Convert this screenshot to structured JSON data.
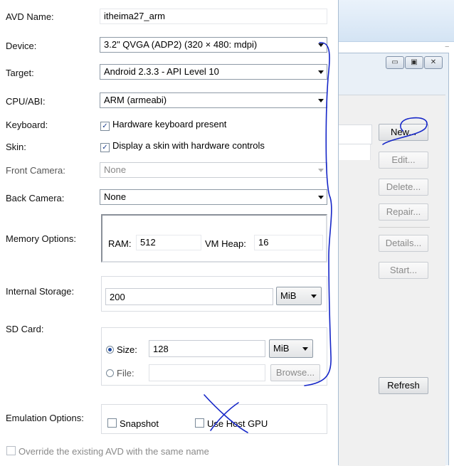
{
  "form": {
    "avd_name": {
      "label": "AVD Name:",
      "value": "itheima27_arm"
    },
    "device": {
      "label": "Device:",
      "value": "3.2\" QVGA (ADP2) (320 × 480: mdpi)"
    },
    "target": {
      "label": "Target:",
      "value": "Android 2.3.3 - API Level 10"
    },
    "cpu_abi": {
      "label": "CPU/ABI:",
      "value": "ARM (armeabi)"
    },
    "keyboard": {
      "label": "Keyboard:",
      "option": "Hardware keyboard present",
      "checked": true
    },
    "skin": {
      "label": "Skin:",
      "option": "Display a skin with hardware controls",
      "checked": true
    },
    "front_camera": {
      "label": "Front Camera:",
      "value": "None"
    },
    "back_camera": {
      "label": "Back Camera:",
      "value": "None"
    },
    "memory": {
      "label": "Memory Options:",
      "ram_label": "RAM:",
      "ram_value": "512",
      "vm_heap_label": "VM Heap:",
      "vm_heap_value": "16"
    },
    "internal_storage": {
      "label": "Internal Storage:",
      "value": "200",
      "unit": "MiB"
    },
    "sd_card": {
      "label": "SD Card:",
      "size_label": "Size:",
      "size_value": "128",
      "size_unit": "MiB",
      "file_label": "File:",
      "file_value": "",
      "browse_label": "Browse..."
    },
    "emulation": {
      "label": "Emulation Options:",
      "snapshot": "Snapshot",
      "use_host_gpu": "Use Host GPU"
    },
    "override": {
      "label": "Override the existing AVD with the same name"
    }
  },
  "manager": {
    "buttons": {
      "new": "New...",
      "edit": "Edit...",
      "delete": "Delete...",
      "repair": "Repair...",
      "details": "Details...",
      "start": "Start...",
      "refresh": "Refresh"
    },
    "window_controls": [
      "minimize-icon",
      "maximize-icon",
      "close-icon"
    ]
  },
  "colors": {
    "annotation": "#1526c8",
    "disabled_text": "#8a8a8a"
  }
}
